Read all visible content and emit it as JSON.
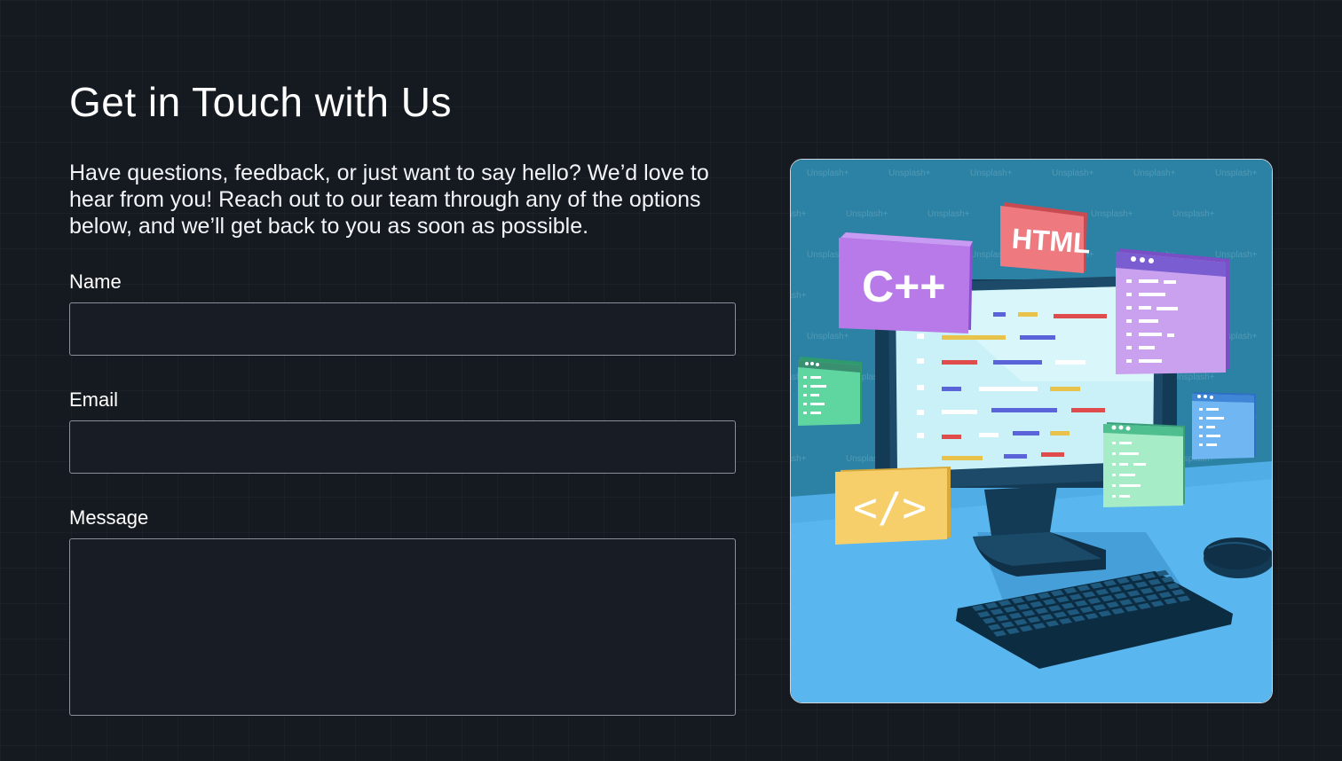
{
  "header": {
    "title": "Get in Touch with Us",
    "intro": "Have questions, feedback, or just want to say hello? We’d love to hear from you! Reach out to our team through any of the options below, and we’ll get back to you as soon as possible."
  },
  "form": {
    "name_label": "Name",
    "name_value": "",
    "email_label": "Email",
    "email_value": "",
    "message_label": "Message",
    "message_value": ""
  },
  "illustration": {
    "cards": [
      "C++",
      "HTML",
      "</>"
    ],
    "watermark": "Unsplash+"
  },
  "colors": {
    "background": "#151a21",
    "field_border": "#8a9099",
    "illustration_bg": "#2a7fa0",
    "desk": "#5ab6ef"
  }
}
